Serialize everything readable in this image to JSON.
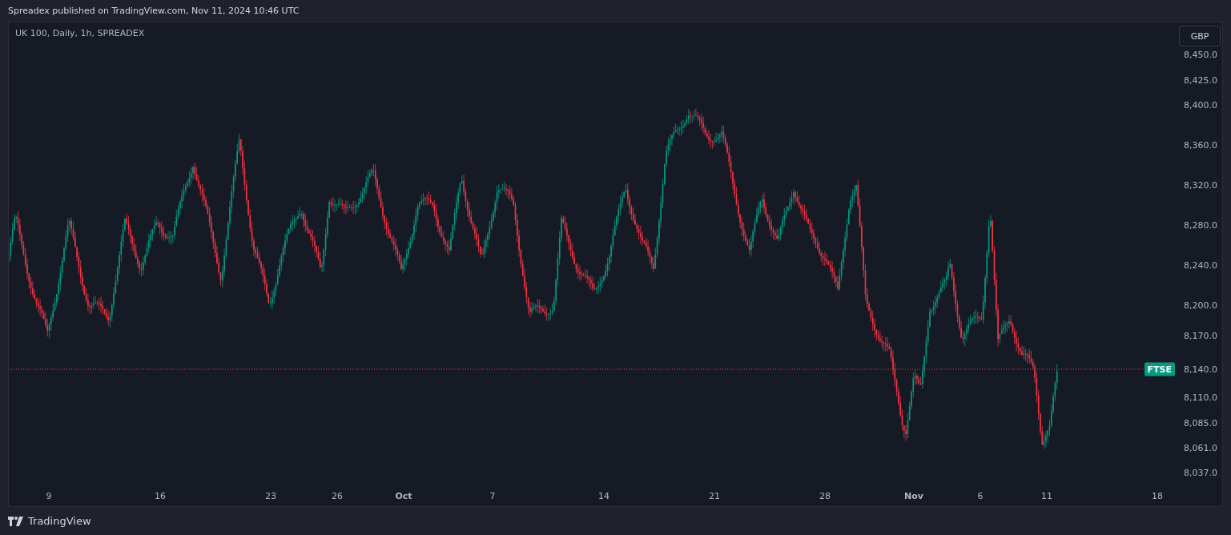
{
  "header": {
    "text": "Spreadex published on TradingView.com, Nov 11, 2024 10:46 UTC"
  },
  "chart": {
    "legend": "UK 100, Daily, 1h, SPREADEX",
    "currency_button": "GBP",
    "price_badge": "FTSE",
    "price_axis": [
      "8,450.0",
      "8,425.0",
      "8,400.0",
      "8,360.0",
      "8,320.0",
      "8,280.0",
      "8,240.0",
      "8,200.0",
      "8,170.0",
      "8,140.0",
      "8,110.0",
      "8,085.0",
      "8,061.0",
      "8,037.0"
    ],
    "time_axis": [
      {
        "label": "9",
        "kind": "day"
      },
      {
        "label": "16",
        "kind": "day"
      },
      {
        "label": "23",
        "kind": "day"
      },
      {
        "label": "26",
        "kind": "day"
      },
      {
        "label": "Oct",
        "kind": "month"
      },
      {
        "label": "7",
        "kind": "day"
      },
      {
        "label": "14",
        "kind": "day"
      },
      {
        "label": "21",
        "kind": "day"
      },
      {
        "label": "28",
        "kind": "day"
      },
      {
        "label": "Nov",
        "kind": "month"
      },
      {
        "label": "6",
        "kind": "day"
      },
      {
        "label": "11",
        "kind": "day"
      },
      {
        "label": "18",
        "kind": "day"
      }
    ]
  },
  "footer": {
    "brand": "TradingView"
  }
}
